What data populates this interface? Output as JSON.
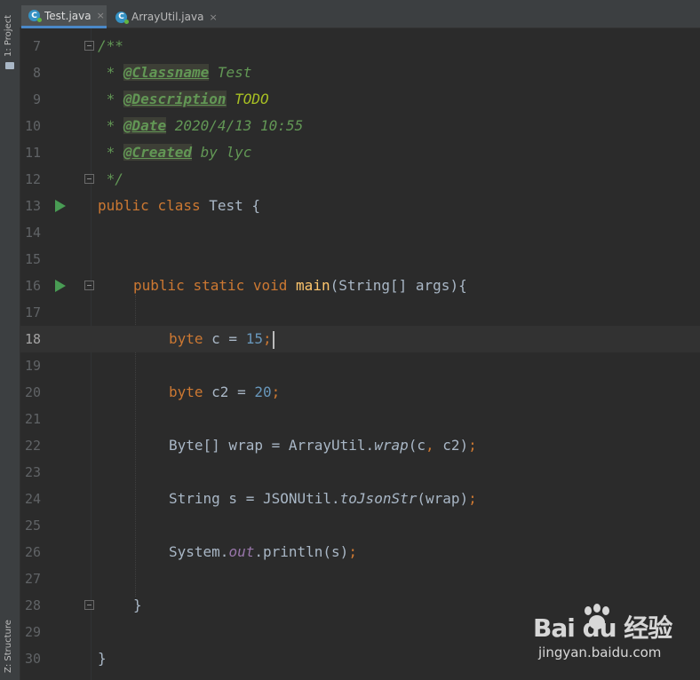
{
  "sidebar": {
    "project_tab": "1: Project",
    "structure_tab": "Z: Structure"
  },
  "tabs": [
    {
      "label": "Test.java",
      "active": true,
      "close": "×"
    },
    {
      "label": "ArrayUtil.java",
      "active": false,
      "close": "×"
    }
  ],
  "class_icon_letter": "C",
  "colors": {
    "keyword": "#cc7832",
    "number": "#6897bb",
    "method": "#ffc66d",
    "doc": "#629755",
    "todo": "#a8c023",
    "field": "#9876aa",
    "run_icon": "#499c54",
    "active_tab_underline": "#4a88c7"
  },
  "icons": {
    "run": "run-triangle-icon",
    "fold": "fold-minus-icon",
    "class": "class-c-icon",
    "close": "close-icon"
  },
  "current_line": 18,
  "code": {
    "l7": {
      "open": "/**"
    },
    "l8": {
      "star": " * ",
      "tag": "@Classname",
      "text": " Test"
    },
    "l9": {
      "star": " * ",
      "tag": "@Description",
      "text": " TODO"
    },
    "l10": {
      "star": " * ",
      "tag": "@Date",
      "text": " 2020/4/13 10:55"
    },
    "l11": {
      "star": " * ",
      "tag": "@Created",
      "text": " by lyc"
    },
    "l12": {
      "close": " */"
    },
    "l13": {
      "kw1": "public",
      "kw2": "class",
      "name": "Test",
      "brace": "{"
    },
    "l16": {
      "kw1": "public",
      "kw2": "static",
      "kw3": "void",
      "method": "main",
      "params": "(String[] args){"
    },
    "l18": {
      "type": "byte",
      "decl": " c = ",
      "num": "15",
      "semi": ";"
    },
    "l20": {
      "type": "byte",
      "decl": " c2 = ",
      "num": "20",
      "semi": ";"
    },
    "l22": {
      "pre": "Byte[] wrap = ArrayUtil.",
      "call": "wrap",
      "args1": "(c",
      "comma": ",",
      "args2": " c2)",
      "semi": ";"
    },
    "l24": {
      "pre": "String s = JSONUtil.",
      "call": "toJsonStr",
      "args": "(wrap)",
      "semi": ";"
    },
    "l26": {
      "pre": "System.",
      "field": "out",
      "rest": ".println(s)",
      "semi": ";"
    },
    "l28": {
      "brace": "}"
    },
    "l30": {
      "brace": "}"
    }
  },
  "line_numbers": [
    "7",
    "8",
    "9",
    "10",
    "11",
    "12",
    "13",
    "14",
    "15",
    "16",
    "17",
    "18",
    "19",
    "20",
    "21",
    "22",
    "23",
    "24",
    "25",
    "26",
    "27",
    "28",
    "29",
    "30"
  ],
  "watermark": {
    "brand": "Bai du 经验",
    "url": "jingyan.baidu.com"
  }
}
